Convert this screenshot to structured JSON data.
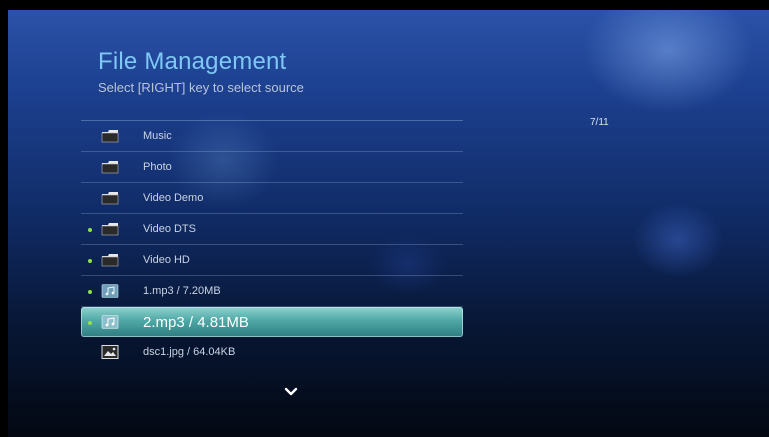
{
  "header": {
    "title": "File Management",
    "subtitle": "Select [RIGHT] key to select source"
  },
  "pager": {
    "position": "7/11"
  },
  "items": [
    {
      "label": "Music",
      "icon": "folder-icon",
      "marked": false
    },
    {
      "label": "Photo",
      "icon": "folder-icon",
      "marked": false
    },
    {
      "label": "Video Demo",
      "icon": "folder-icon",
      "marked": false
    },
    {
      "label": "Video DTS",
      "icon": "folder-icon",
      "marked": true
    },
    {
      "label": "Video HD",
      "icon": "folder-icon",
      "marked": true
    },
    {
      "label": "1.mp3 / 7.20MB",
      "icon": "music-file-icon",
      "marked": true
    },
    {
      "label": "2.mp3 / 4.81MB",
      "icon": "music-file-icon",
      "marked": true,
      "selected": true
    },
    {
      "label": "dsc1.jpg / 64.04KB",
      "icon": "image-file-icon",
      "marked": false
    }
  ],
  "footer": {
    "icon": "chevron-down-icon"
  },
  "colors": {
    "title": "#7fc8f5",
    "selection": "#4fa8a6",
    "marker": "#8fe04a"
  }
}
